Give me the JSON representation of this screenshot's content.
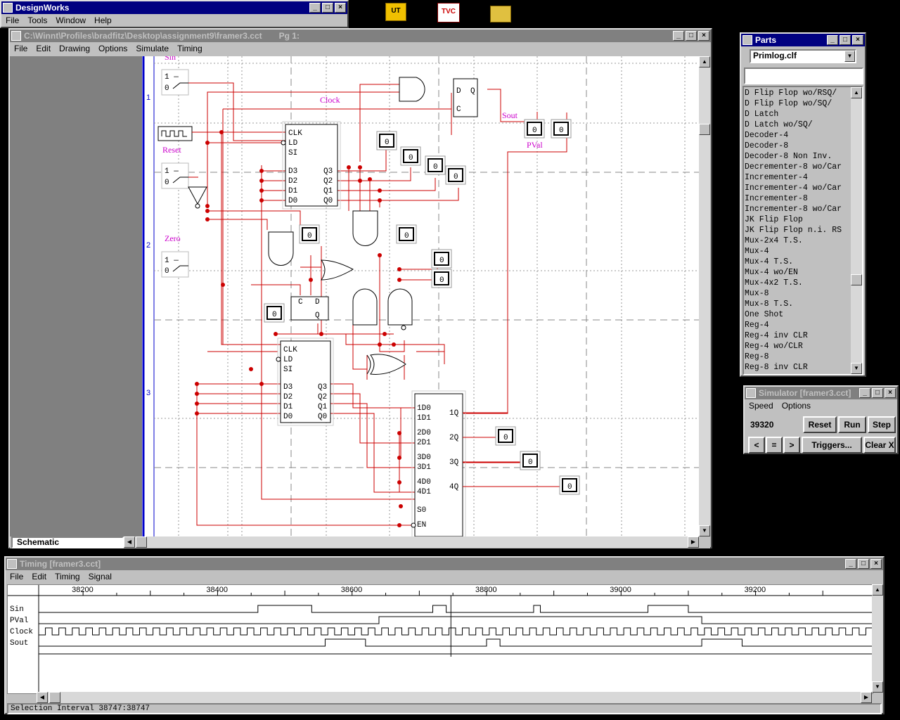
{
  "colors": {
    "desktop": "#000000",
    "titlebar_active": "#000080",
    "titlebar_inactive": "#808080",
    "wire": "#cc0000",
    "label": "#cc00cc",
    "grid": "#808080",
    "page_margin": "#0000cc"
  },
  "designworks": {
    "title": "DesignWorks",
    "menu": [
      "File",
      "Tools",
      "Window",
      "Help"
    ]
  },
  "desktop_icons": [
    {
      "name": "ut-shortcut-icon",
      "label": "UT"
    },
    {
      "name": "tvc-shortcut-icon",
      "label": "TVC"
    },
    {
      "name": "folder-shortcut-icon",
      "label": ""
    }
  ],
  "schematic": {
    "title": "C:\\Winnt\\Profiles\\bradfitz\\Desktop\\assignment9\\framer3.cct",
    "page": "Pg 1:",
    "menu": [
      "File",
      "Edit",
      "Drawing",
      "Options",
      "Simulate",
      "Timing"
    ],
    "status": "Schematic",
    "row_markers": [
      "1",
      "2",
      "3"
    ],
    "labels": {
      "sin": "Sin",
      "clock": "Clock",
      "sout": "Sout",
      "pval": "PVal",
      "reset": "Reset",
      "zero": "Zero"
    },
    "switch_one": "1",
    "switch_zero": "0",
    "probe_value": "0",
    "reg_pins_left": [
      "CLK",
      "LD",
      "SI",
      "D3",
      "D2",
      "D1",
      "D0"
    ],
    "reg_pins_right": [
      "Q3",
      "Q2",
      "Q1",
      "Q0"
    ],
    "dff_pins": [
      "D",
      "Q",
      "C"
    ],
    "mux_pins_left": [
      "1D0",
      "1D1",
      "2D0",
      "2D1",
      "3D0",
      "3D1",
      "4D0",
      "4D1",
      "S0",
      "EN"
    ],
    "mux_pins_right": [
      "1Q",
      "2Q",
      "3Q",
      "4Q"
    ],
    "small_ff_pins": [
      "C",
      "D",
      "Q"
    ]
  },
  "parts": {
    "title": "Parts",
    "library": "Primlog.clf",
    "search": "",
    "items": [
      "D Flip Flop wo/RSQ/",
      "D Flip Flop wo/SQ/",
      "D Latch",
      "D Latch wo/SQ/",
      "Decoder-4",
      "Decoder-8",
      "Decoder-8 Non Inv.",
      "Decrementer-8 wo/Car",
      "Incrementer-4",
      "Incrementer-4 wo/Car",
      "Incrementer-8",
      "Incrementer-8 wo/Car",
      "JK Flip Flop",
      "JK Flip Flop n.i. RS",
      "Mux-2x4 T.S.",
      "Mux-4",
      "Mux-4 T.S.",
      "Mux-4 wo/EN",
      "Mux-4x2 T.S.",
      "Mux-8",
      "Mux-8 T.S.",
      "One Shot",
      "Reg-4",
      "Reg-4 inv CLR",
      "Reg-4 wo/CLR",
      "Reg-8",
      "Reg-8 inv CLR"
    ]
  },
  "simulator": {
    "title": "Simulator [framer3.cct]",
    "menu": [
      "Speed",
      "Options"
    ],
    "time": "39320",
    "buttons": {
      "reset": "Reset",
      "run": "Run",
      "step": "Step",
      "triggers": "Triggers...",
      "clear": "Clear X",
      "back": "<",
      "equal": "=",
      "fwd": ">"
    }
  },
  "timing": {
    "title": "Timing [framer3.cct]",
    "menu": [
      "File",
      "Edit",
      "Timing",
      "Signal"
    ],
    "ruler": [
      "38200",
      "38400",
      "38600",
      "38800",
      "39000",
      "39200"
    ],
    "signals": [
      "Sin",
      "PVal",
      "Clock",
      "Sout"
    ],
    "status": "Selection Interval 38747:38747",
    "cursor_time": 38747,
    "time_start": 38134,
    "time_end": 39374,
    "waves": {
      "Sin": [
        [
          38134,
          0
        ],
        [
          38460,
          1
        ],
        [
          38540,
          0
        ],
        [
          38720,
          1
        ],
        [
          38740,
          0
        ],
        [
          38870,
          1
        ],
        [
          38880,
          0
        ],
        [
          39040,
          1
        ],
        [
          39100,
          0
        ]
      ],
      "PVal": [
        [
          38134,
          0
        ],
        [
          38640,
          1
        ],
        [
          39120,
          0
        ]
      ],
      "Sout": [
        [
          38134,
          0
        ],
        [
          38560,
          1
        ],
        [
          38620,
          0
        ],
        [
          38800,
          1
        ],
        [
          38820,
          0
        ],
        [
          39120,
          1
        ],
        [
          39180,
          0
        ]
      ]
    }
  }
}
